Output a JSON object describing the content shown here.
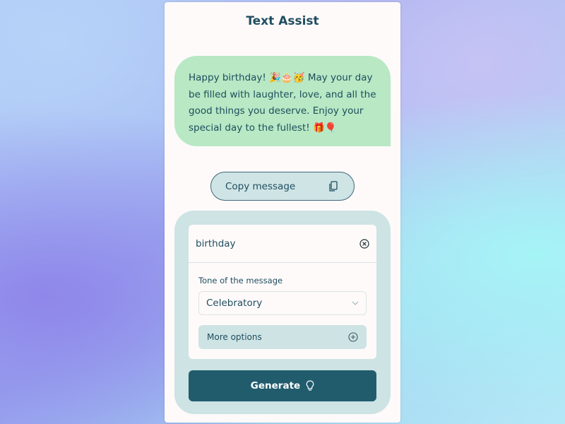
{
  "app": {
    "title": "Text Assist"
  },
  "message": {
    "text": "Happy birthday! 🎉🎂🥳 May your day be filled with laughter, love, and all the good things you deserve. Enjoy your special day to the fullest! 🎁🎈"
  },
  "copy_button": {
    "label": "Copy message",
    "icon": "copy-icon"
  },
  "form": {
    "topic_value": "birthday",
    "clear_icon": "close-circle-icon",
    "tone_label": "Tone of the message",
    "tone_selected": "Celebratory",
    "more_options_label": "More options",
    "generate_label": "Generate"
  },
  "colors": {
    "title": "#1f4e5f",
    "bubble_bg": "#b8e8c4",
    "card_bg": "#cde3e4",
    "generate_bg": "#215c6d"
  }
}
